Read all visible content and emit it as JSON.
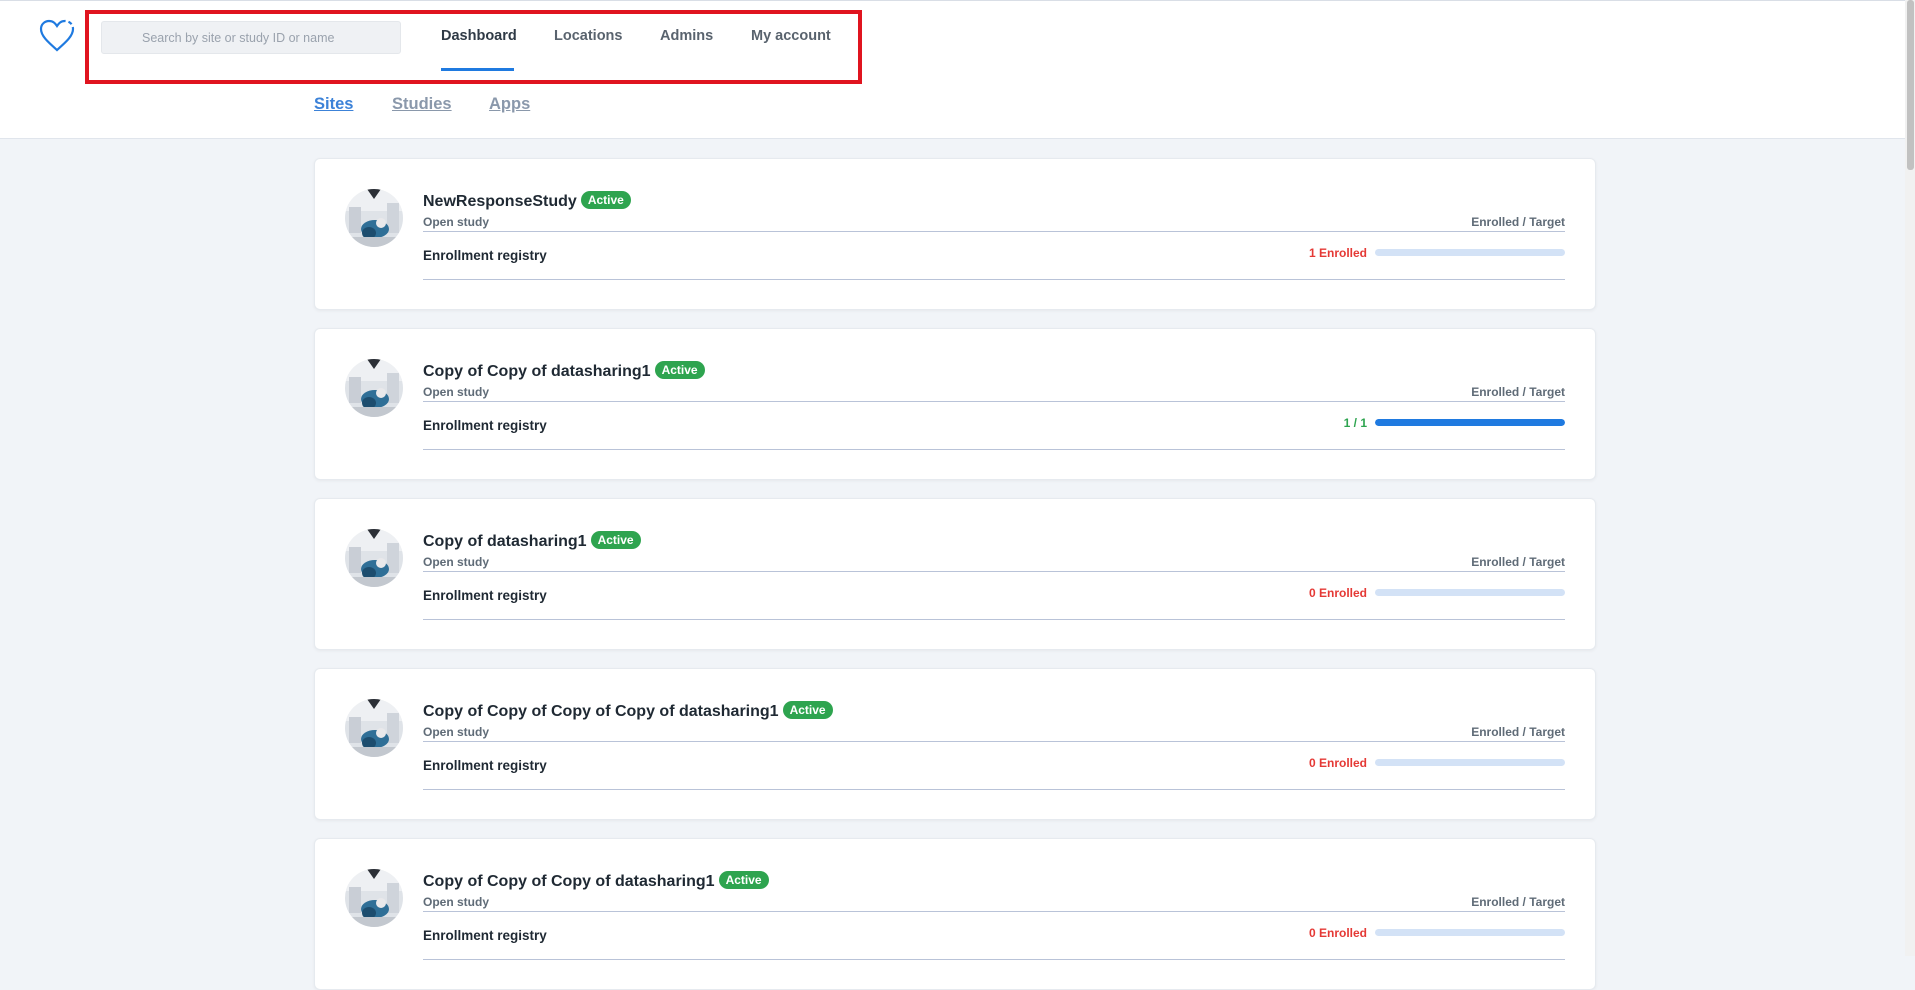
{
  "header": {
    "search_placeholder": "Search by site or study ID or name",
    "nav": [
      {
        "label": "Dashboard",
        "active": true
      },
      {
        "label": "Locations",
        "active": false
      },
      {
        "label": "Admins",
        "active": false
      },
      {
        "label": "My account",
        "active": false
      }
    ]
  },
  "subtabs": [
    {
      "label": "Sites",
      "active": true
    },
    {
      "label": "Studies",
      "active": false
    },
    {
      "label": "Apps",
      "active": false
    }
  ],
  "colors": {
    "accent": "#1f7ae0",
    "active_badge": "#2ea44f",
    "enrolled_red": "#e53935",
    "highlight_box": "#e0141f"
  },
  "studies": [
    {
      "title": "NewResponseStudy",
      "badge": "Active",
      "type": "Open study",
      "target_label": "Enrolled / Target",
      "registry": "Enrollment registry",
      "enrolled": "1 Enrolled",
      "enrolled_color": "red",
      "progress": 0
    },
    {
      "title": "Copy of Copy of datasharing1",
      "badge": "Active",
      "type": "Open study",
      "target_label": "Enrolled / Target",
      "registry": "Enrollment registry",
      "enrolled": "1 / 1",
      "enrolled_color": "green",
      "progress": 1
    },
    {
      "title": "Copy of datasharing1",
      "badge": "Active",
      "type": "Open study",
      "target_label": "Enrolled / Target",
      "registry": "Enrollment registry",
      "enrolled": "0 Enrolled",
      "enrolled_color": "red",
      "progress": 0
    },
    {
      "title": "Copy of Copy of Copy of Copy of datasharing1",
      "badge": "Active",
      "type": "Open study",
      "target_label": "Enrolled / Target",
      "registry": "Enrollment registry",
      "enrolled": "0 Enrolled",
      "enrolled_color": "red",
      "progress": 0
    },
    {
      "title": "Copy of Copy of Copy of datasharing1",
      "badge": "Active",
      "type": "Open study",
      "target_label": "Enrolled / Target",
      "registry": "Enrollment registry",
      "enrolled": "0 Enrolled",
      "enrolled_color": "red",
      "progress": 0
    }
  ]
}
